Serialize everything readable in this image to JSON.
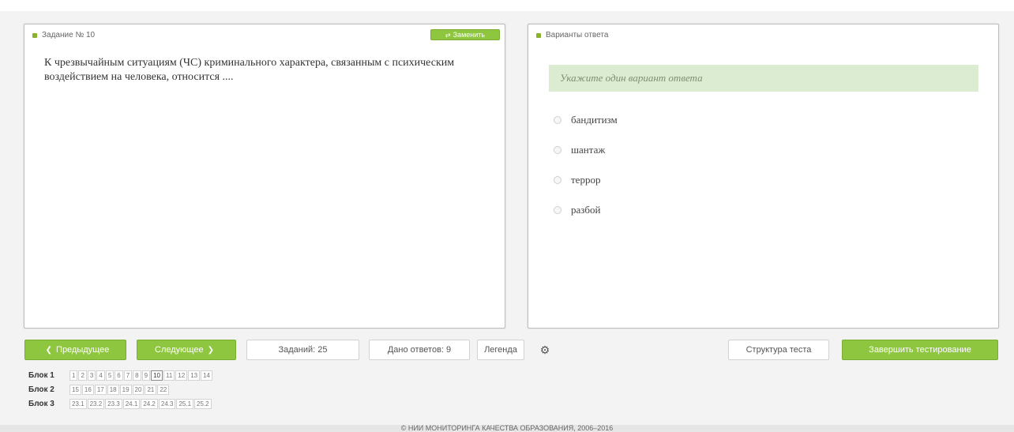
{
  "left_panel": {
    "header": "Задание № 10",
    "action_label": "Заменить",
    "question": "К чрезвычайным ситуациям (ЧС) криминального характера, связанным с психическим воздействием на человека, относится ...."
  },
  "right_panel": {
    "header": "Варианты ответа",
    "hint": "Укажите один вариант ответа",
    "options": [
      "бандитизм",
      "шантаж",
      "террор",
      "разбой"
    ]
  },
  "toolbar": {
    "prev_label": "Предыдущее",
    "next_label": "Следующее",
    "tasks_label": "Заданий: 25",
    "answered_label": "Дано ответов: 9",
    "legend_label": "Легенда",
    "structure_label": "Структура теста",
    "finish_label": "Завершить тестирование"
  },
  "blocks": [
    {
      "label": "Блок 1",
      "cells": [
        "1",
        "2",
        "3",
        "4",
        "5",
        "6",
        "7",
        "8",
        "9",
        "10",
        "11",
        "12",
        "13",
        "14"
      ],
      "current": "10"
    },
    {
      "label": "Блок 2",
      "cells": [
        "15",
        "16",
        "17",
        "18",
        "19",
        "20",
        "21",
        "22"
      ]
    },
    {
      "label": "Блок 3",
      "cells": [
        "23.1",
        "23.2",
        "23.3",
        "24.1",
        "24.2",
        "24.3",
        "25.1",
        "25.2"
      ]
    }
  ],
  "footer": "© НИИ МОНИТОРИНГА КАЧЕСТВА ОБРАЗОВАНИЯ, 2006–2016",
  "colors": {
    "accent": "#8ec63f",
    "hint_bg": "#dcecd2",
    "dot": "#8bb32a"
  }
}
